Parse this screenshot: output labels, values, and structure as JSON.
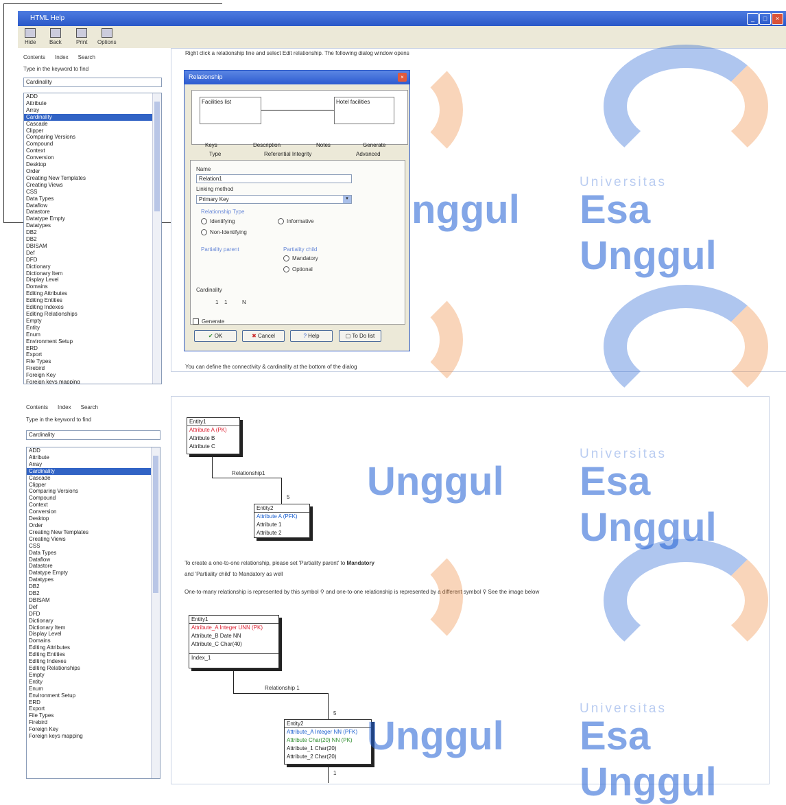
{
  "window": {
    "title": "HTML Help"
  },
  "toolbar": {
    "hide": "Hide",
    "back": "Back",
    "print": "Print",
    "options": "Options"
  },
  "nav_tabs": {
    "contents": "Contents",
    "index": "Index",
    "search": "Search"
  },
  "keyword_prompt": "Type in the keyword to find",
  "keyword_value": "Cardinality",
  "index_items_top": [
    "ADD",
    "Attribute",
    "Array",
    "Cardinality",
    "Cascade",
    "Clipper",
    "Comparing Versions",
    "Compound",
    "Context",
    "Conversion",
    "Desktop",
    "Order",
    "Creating New Templates",
    "Creating Views",
    "CSS",
    "Data Types",
    "Dataflow",
    "Datastore",
    "Datatype Empty",
    "Datatypes",
    "DB2",
    "DB2",
    "DBISAM",
    "Def",
    "DFD",
    "Dictionary",
    "Dictionary Item",
    "Display Level",
    "Domains",
    "Editing Attributes",
    "Editing Entities",
    "Editing Indexes",
    "Editing Relationships",
    "Empty",
    "Entity",
    "Enum",
    "Environment Setup",
    "ERD",
    "Export",
    "File Types",
    "Firebird",
    "Foreign Key",
    "Foreign keys mapping"
  ],
  "index_items_bottom": [
    "ADD",
    "Attribute",
    "Array",
    "Cardinality",
    "Cascade",
    "Clipper",
    "Comparing Versions",
    "Compound",
    "Context",
    "Conversion",
    "Desktop",
    "Order",
    "Creating New Templates",
    "Creating Views",
    "CSS",
    "Data Types",
    "Dataflow",
    "Datastore",
    "Datatype Empty",
    "Datatypes",
    "DB2",
    "DB2",
    "DBISAM",
    "Def",
    "DFD",
    "Dictionary",
    "Dictionary Item",
    "Display Level",
    "Domains",
    "Editing Attributes",
    "Editing Entities",
    "Editing Indexes",
    "Editing Relationships",
    "Empty",
    "Entity",
    "Enum",
    "Environment Setup",
    "ERD",
    "Export",
    "File Types",
    "Firebird",
    "Foreign Key",
    "Foreign keys mapping"
  ],
  "intro_text": "Right click a relationship line and select Edit relationship. The following dialog window opens",
  "dialog": {
    "title": "Relationship",
    "entity_left": "Facilities list",
    "entity_right": "Hotel facilities",
    "tabs_row1": [
      "Keys",
      "Description",
      "Notes",
      "Generate"
    ],
    "tabs_row2": [
      "Type",
      "Referential Integrity",
      "Advanced"
    ],
    "name_label": "Name",
    "name_value": "Relation1",
    "linking_label": "Linking method",
    "linking_value": "Primary Key",
    "rel_type_label": "Relationship Type",
    "identifying": "Identifying",
    "informative": "Informative",
    "non_identifying": "Non-Identifying",
    "parent_label": "Partiality parent",
    "child_label": "Partiality child",
    "mandatory": "Mandatory",
    "optional": "Optional",
    "cardinality_label": "Cardinality",
    "card_1": "1",
    "card_2": "1",
    "card_n": "N",
    "generate": "Generate",
    "ok": "OK",
    "cancel": "Cancel",
    "help": "Help",
    "todo": "To Do list"
  },
  "dialog_caption": "You can define the connectivity & cardinality at the bottom of the dialog",
  "erd1": {
    "e1_title": "Entity1",
    "e1_a": "Attribute A (PK)",
    "e1_b": "Attribute B",
    "e1_c": "Attribute C",
    "rel": "Relationship1",
    "card": "5",
    "e2_title": "Entity2",
    "e2_a": "Attribute A (PFK)",
    "e2_1": "Attribute 1",
    "e2_2": "Attribute 2"
  },
  "para1_a": "To create a one-to-one relationship, please set 'Partiality parent' to",
  "para1_b": "Mandatory",
  "para2": "and 'Partiality child' to Mandatory as well",
  "para3_a": "One-to-many relationship is represented by this symbol",
  "para3_b": "and one-to-one relationship is represented by a different symbol",
  "para3_c": "See the image below",
  "erd2": {
    "e1_title": "Entity1",
    "e1_a": "Attribute_A Integer UNN (PK)",
    "e1_b": "Attribute_B Date NN",
    "e1_c": "Attribute_C Char(40)",
    "e1_idx": "Index_1",
    "rel": "Relationship 1",
    "card": "5",
    "e2_title": "Entity2",
    "e2_a": "Attribute_A Integer NN (PFK)",
    "e2_b": "Attribute Char(20) NN (PK)",
    "e2_1": "Attribute_1 Char(20)",
    "e2_2": "Attribute_2 Char(20)",
    "card2": "1"
  },
  "watermark": {
    "small": "Universitas",
    "big": "Esa Unggul",
    "partial1": "nggul",
    "partial2": "Unggul"
  },
  "colors": {
    "accent": "#2a58c8",
    "watermark_blue": "#1e5fd4",
    "watermark_orange": "#f08a3c"
  }
}
